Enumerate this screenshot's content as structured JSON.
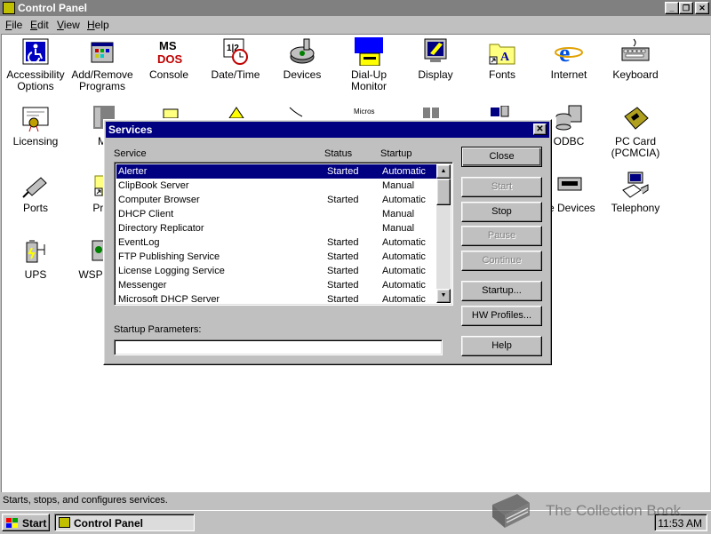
{
  "window": {
    "title": "Control Panel"
  },
  "menus": [
    "File",
    "Edit",
    "View",
    "Help"
  ],
  "menu_accels": [
    "F",
    "E",
    "V",
    "H"
  ],
  "control_panel_items": [
    {
      "label": "Accessibility Options"
    },
    {
      "label": "Add/Remove Programs"
    },
    {
      "label": "Console"
    },
    {
      "label": "Date/Time"
    },
    {
      "label": "Devices"
    },
    {
      "label": "Dial-Up Monitor"
    },
    {
      "label": "Display"
    },
    {
      "label": "Fonts"
    },
    {
      "label": "Internet"
    },
    {
      "label": "Keyboard"
    },
    {
      "label": "Licensing"
    },
    {
      "label": "M"
    },
    {
      "label": "ODBC"
    },
    {
      "label": "PC Card (PCMCIA)"
    },
    {
      "label": "Ports"
    },
    {
      "label": "Prin"
    },
    {
      "label": "pe Devices"
    },
    {
      "label": "Telephony"
    },
    {
      "label": "UPS"
    },
    {
      "label": "WSP"
    }
  ],
  "status_bar": "Starts, stops, and configures services.",
  "taskbar": {
    "start": "Start",
    "task": "Control Panel",
    "clock": "11:53 AM"
  },
  "dialog": {
    "title": "Services",
    "columns": [
      "Service",
      "Status",
      "Startup"
    ],
    "services": [
      {
        "name": "Alerter",
        "status": "Started",
        "startup": "Automatic",
        "selected": true
      },
      {
        "name": "ClipBook Server",
        "status": "",
        "startup": "Manual"
      },
      {
        "name": "Computer Browser",
        "status": "Started",
        "startup": "Automatic"
      },
      {
        "name": "DHCP Client",
        "status": "",
        "startup": "Manual"
      },
      {
        "name": "Directory Replicator",
        "status": "",
        "startup": "Manual"
      },
      {
        "name": "EventLog",
        "status": "Started",
        "startup": "Automatic"
      },
      {
        "name": "FTP Publishing Service",
        "status": "Started",
        "startup": "Automatic"
      },
      {
        "name": "License Logging Service",
        "status": "Started",
        "startup": "Automatic"
      },
      {
        "name": "Messenger",
        "status": "Started",
        "startup": "Automatic"
      },
      {
        "name": "Microsoft DHCP Server",
        "status": "Started",
        "startup": "Automatic"
      }
    ],
    "buttons": {
      "close": "Close",
      "start": "Start",
      "stop": "Stop",
      "pause": "Pause",
      "continue": "Continue",
      "startup": "Startup...",
      "hw_profiles": "HW Profiles...",
      "help": "Help"
    },
    "startup_parameters_label": "Startup Parameters:",
    "startup_parameters_value": ""
  },
  "watermark": "The Collection Book",
  "colors": {
    "title_active": "#000080",
    "title_inactive": "#808080",
    "face": "#c0c0c0",
    "selection": "#000080"
  }
}
